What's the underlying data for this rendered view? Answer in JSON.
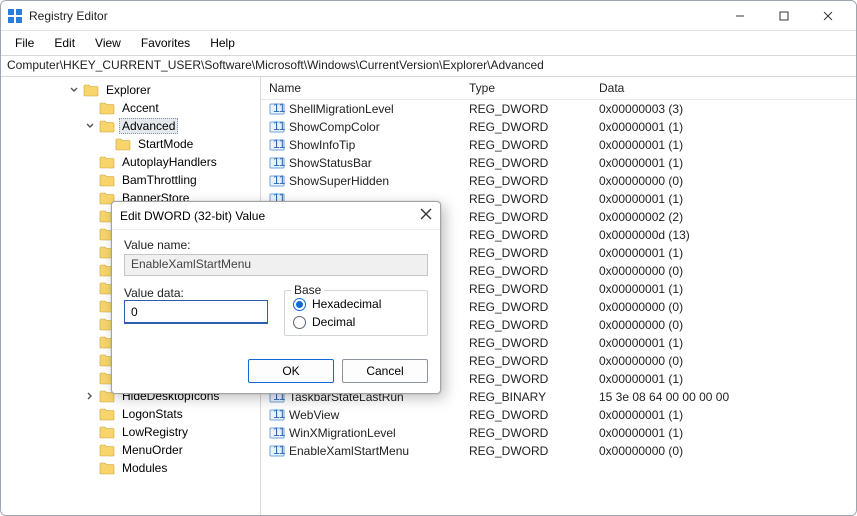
{
  "window": {
    "title": "Registry Editor",
    "menu": {
      "file": "File",
      "edit": "Edit",
      "view": "View",
      "favorites": "Favorites",
      "help": "Help"
    },
    "address": "Computer\\HKEY_CURRENT_USER\\Software\\Microsoft\\Windows\\CurrentVersion\\Explorer\\Advanced"
  },
  "tree": {
    "items": [
      {
        "depth": 4,
        "state": "open",
        "label": "Explorer",
        "selected": false
      },
      {
        "depth": 5,
        "state": "leaf",
        "label": "Accent",
        "selected": false
      },
      {
        "depth": 5,
        "state": "open",
        "label": "Advanced",
        "selected": true
      },
      {
        "depth": 6,
        "state": "leaf",
        "label": "StartMode",
        "selected": false
      },
      {
        "depth": 5,
        "state": "leaf",
        "label": "AutoplayHandlers",
        "selected": false
      },
      {
        "depth": 5,
        "state": "leaf",
        "label": "BamThrottling",
        "selected": false
      },
      {
        "depth": 5,
        "state": "leaf",
        "label": "BannerStore",
        "selected": false
      },
      {
        "depth": 5,
        "state": "leaf",
        "label": "",
        "selected": false
      },
      {
        "depth": 5,
        "state": "leaf",
        "label": "",
        "selected": false
      },
      {
        "depth": 5,
        "state": "leaf",
        "label": "",
        "selected": false
      },
      {
        "depth": 5,
        "state": "leaf",
        "label": "",
        "selected": false
      },
      {
        "depth": 5,
        "state": "leaf",
        "label": "",
        "selected": false
      },
      {
        "depth": 5,
        "state": "leaf",
        "label": "",
        "selected": false
      },
      {
        "depth": 5,
        "state": "leaf",
        "label": "",
        "selected": false
      },
      {
        "depth": 5,
        "state": "leaf",
        "label": "",
        "selected": false
      },
      {
        "depth": 5,
        "state": "leaf",
        "label": "",
        "selected": false
      },
      {
        "depth": 5,
        "state": "leaf",
        "label": "",
        "selected": false
      },
      {
        "depth": 5,
        "state": "close",
        "label": "HideDesktopIcons",
        "selected": false
      },
      {
        "depth": 5,
        "state": "leaf",
        "label": "LogonStats",
        "selected": false
      },
      {
        "depth": 5,
        "state": "leaf",
        "label": "LowRegistry",
        "selected": false
      },
      {
        "depth": 5,
        "state": "leaf",
        "label": "MenuOrder",
        "selected": false
      },
      {
        "depth": 5,
        "state": "leaf",
        "label": "Modules",
        "selected": false
      }
    ]
  },
  "list": {
    "col_name": "Name",
    "col_type": "Type",
    "col_data": "Data",
    "rows": [
      {
        "name": "ShellMigrationLevel",
        "type": "REG_DWORD",
        "data": "0x00000003 (3)"
      },
      {
        "name": "ShowCompColor",
        "type": "REG_DWORD",
        "data": "0x00000001 (1)"
      },
      {
        "name": "ShowInfoTip",
        "type": "REG_DWORD",
        "data": "0x00000001 (1)"
      },
      {
        "name": "ShowStatusBar",
        "type": "REG_DWORD",
        "data": "0x00000001 (1)"
      },
      {
        "name": "ShowSuperHidden",
        "type": "REG_DWORD",
        "data": "0x00000000 (0)"
      },
      {
        "name": "",
        "type": "REG_DWORD",
        "data": "0x00000001 (1)"
      },
      {
        "name": "",
        "type": "REG_DWORD",
        "data": "0x00000002 (2)"
      },
      {
        "name": "",
        "type": "REG_DWORD",
        "data": "0x0000000d (13)"
      },
      {
        "name": "",
        "type": "REG_DWORD",
        "data": "0x00000001 (1)"
      },
      {
        "name": "",
        "type": "REG_DWORD",
        "data": "0x00000000 (0)"
      },
      {
        "name": "..",
        "type": "REG_DWORD",
        "data": "0x00000001 (1)"
      },
      {
        "name": "",
        "type": "REG_DWORD",
        "data": "0x00000000 (0)"
      },
      {
        "name": "",
        "type": "REG_DWORD",
        "data": "0x00000000 (0)"
      },
      {
        "name": "",
        "type": "REG_DWORD",
        "data": "0x00000001 (1)"
      },
      {
        "name": "",
        "type": "REG_DWORD",
        "data": "0x00000000 (0)"
      },
      {
        "name": "",
        "type": "REG_DWORD",
        "data": "0x00000001 (1)"
      },
      {
        "name": "TaskbarStateLastRun",
        "type": "REG_BINARY",
        "data": "15 3e 08 64 00 00 00 00"
      },
      {
        "name": "WebView",
        "type": "REG_DWORD",
        "data": "0x00000001 (1)"
      },
      {
        "name": "WinXMigrationLevel",
        "type": "REG_DWORD",
        "data": "0x00000001 (1)"
      },
      {
        "name": "EnableXamlStartMenu",
        "type": "REG_DWORD",
        "data": "0x00000000 (0)"
      }
    ]
  },
  "dialog": {
    "title": "Edit DWORD (32-bit) Value",
    "value_name_label": "Value name:",
    "value_name": "EnableXamlStartMenu",
    "value_data_label": "Value data:",
    "value_data": "0",
    "base_label": "Base",
    "hex_label": "Hexadecimal",
    "dec_label": "Decimal",
    "base_selected": "hex",
    "ok": "OK",
    "cancel": "Cancel"
  }
}
